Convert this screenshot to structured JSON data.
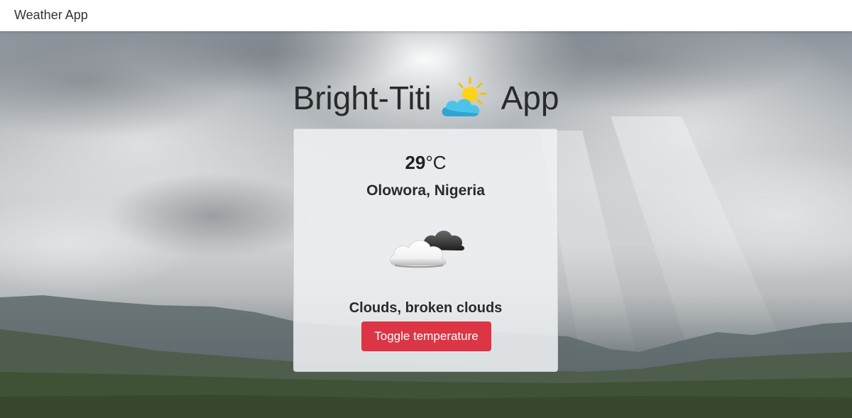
{
  "navbar": {
    "brand": "Weather App"
  },
  "hero": {
    "title_left": "Bright-Titi",
    "title_right": "App",
    "title_icon": "sun-behind-cloud-icon"
  },
  "weather": {
    "temperature": "29",
    "unit": "°C",
    "location": "Olowora, Nigeria",
    "icon": "broken-clouds-icon",
    "description": "Clouds, broken clouds",
    "toggle_label": "Toggle temperature"
  },
  "colors": {
    "button": "#dc3545",
    "navbar": "#ffffff"
  }
}
